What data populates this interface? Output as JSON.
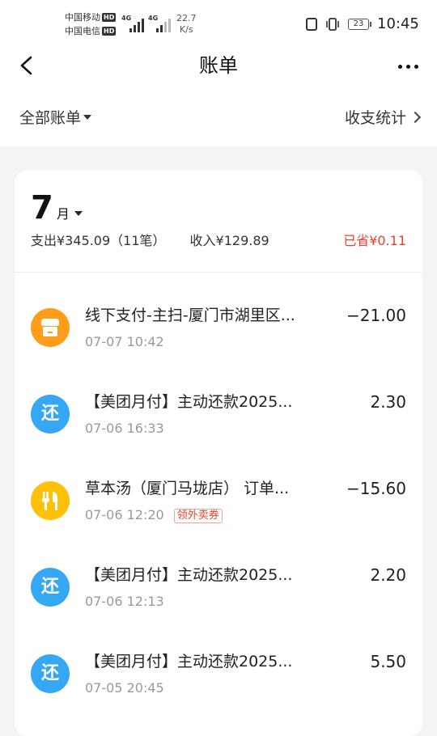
{
  "status_bar": {
    "carrier1": "中国移动",
    "carrier2": "中国电信",
    "hd": "HD",
    "net": "4G",
    "speed_value": "22.7",
    "speed_unit": "K/s",
    "battery": "23",
    "time": "10:45"
  },
  "header": {
    "title": "账单"
  },
  "filter": {
    "label": "全部账单",
    "stats_label": "收支统计"
  },
  "month_card": {
    "month_number": "7",
    "month_unit": "月",
    "expense": "支出¥345.09（11笔）",
    "income": "收入¥129.89",
    "saved": "已省¥0.11"
  },
  "transactions": [
    {
      "title": "线下支付-主扫-厦门市湖里区...",
      "time": "07-07 10:42",
      "amount": "−21.00",
      "icon": "shop-icon",
      "tag": ""
    },
    {
      "title": "【美团月付】主动还款2025...",
      "time": "07-06 16:33",
      "amount": "2.30",
      "icon": "repay-icon",
      "icon_text": "还",
      "tag": ""
    },
    {
      "title": "草本汤（厦门马垅店） 订单...",
      "time": "07-06 12:20",
      "amount": "−15.60",
      "icon": "fork-knife-icon",
      "tag": "领外卖券"
    },
    {
      "title": "【美团月付】主动还款2025...",
      "time": "07-06 12:13",
      "amount": "2.20",
      "icon": "repay-icon",
      "icon_text": "还",
      "tag": ""
    },
    {
      "title": "【美团月付】主动还款2025...",
      "time": "07-05 20:45",
      "amount": "5.50",
      "icon": "repay-icon",
      "icon_text": "还",
      "tag": ""
    }
  ],
  "colors": {
    "accent_red": "#e8412f",
    "blue_icon": "#36a7f5",
    "orange_icon": "#ff9c1a",
    "yellow_icon": "#ffc008"
  }
}
